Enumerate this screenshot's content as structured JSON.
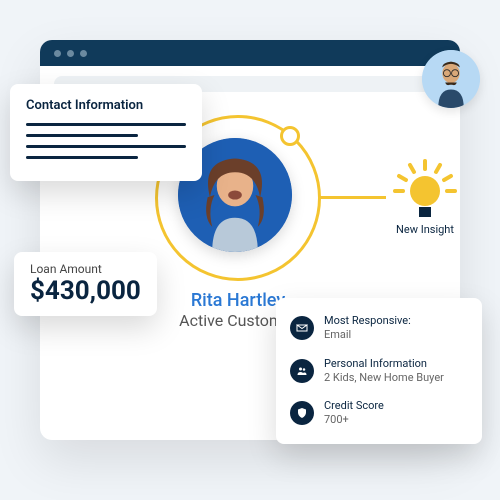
{
  "customer": {
    "name": "Rita Hartley",
    "status": "Active Customer"
  },
  "contact_card": {
    "title": "Contact Information"
  },
  "loan": {
    "label": "Loan Amount",
    "amount": "$430,000"
  },
  "insight": {
    "label": "New Insight"
  },
  "details": [
    {
      "icon": "envelope-icon",
      "title": "Most Responsive:",
      "value": "Email"
    },
    {
      "icon": "people-icon",
      "title": "Personal Information",
      "value": "2 Kids, New Home Buyer"
    },
    {
      "icon": "shield-icon",
      "title": "Credit Score",
      "value": "700+"
    }
  ]
}
